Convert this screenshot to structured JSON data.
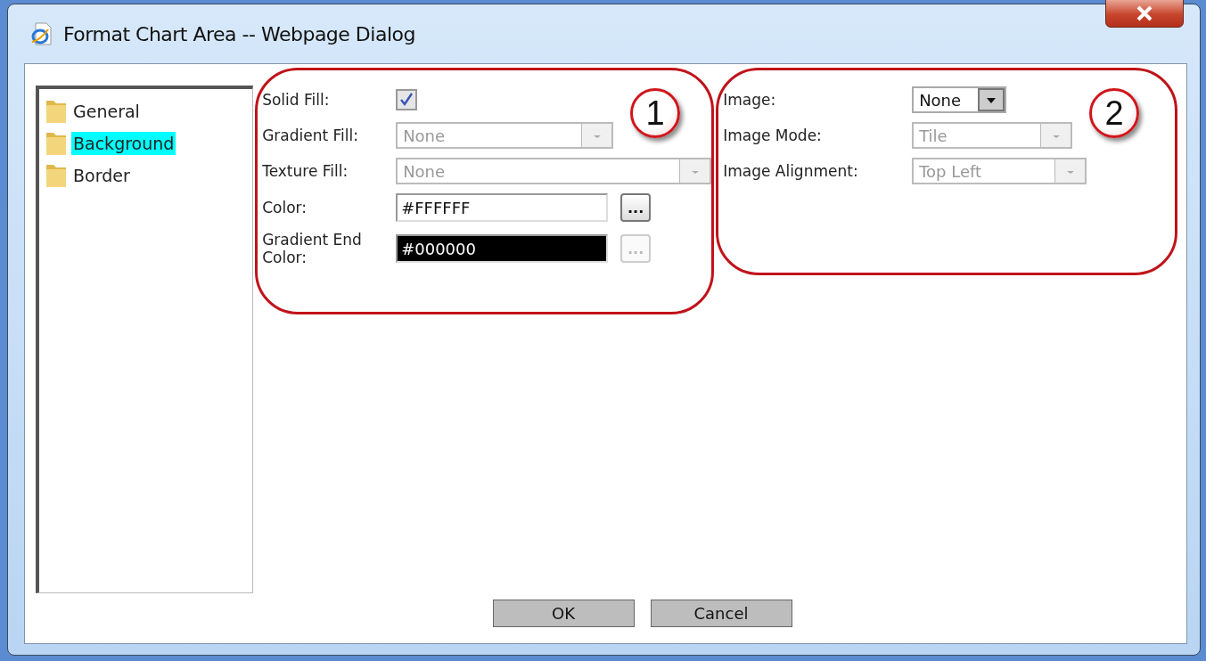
{
  "window": {
    "title": "Format Chart Area -- Webpage Dialog"
  },
  "tree": [
    {
      "label": "General",
      "selected": false
    },
    {
      "label": "Background",
      "selected": true
    },
    {
      "label": "Border",
      "selected": false
    }
  ],
  "sections": [
    {
      "badge": "1",
      "fields": [
        {
          "kind": "checkbox",
          "label": "Solid Fill:",
          "checked": true
        },
        {
          "kind": "select",
          "label": "Gradient Fill:",
          "value": "None",
          "disabled": true
        },
        {
          "kind": "select",
          "label": "Texture Fill:",
          "value": "None",
          "disabled": true
        },
        {
          "kind": "color",
          "label": "Color:",
          "value": "#FFFFFF",
          "color": "#ffffff",
          "button": "...",
          "disabled": false
        },
        {
          "kind": "color",
          "label": "Gradient End Color:",
          "value": "#000000",
          "color": "#000000",
          "button": "...",
          "disabled": true
        }
      ]
    },
    {
      "badge": "2",
      "fields": [
        {
          "kind": "select",
          "label": "Image:",
          "value": "None",
          "disabled": false
        },
        {
          "kind": "select",
          "label": "Image Mode:",
          "value": "Tile",
          "disabled": true
        },
        {
          "kind": "select",
          "label": "Image Alignment:",
          "value": "Top Left",
          "disabled": true
        }
      ]
    }
  ],
  "buttons": [
    "OK",
    "Cancel"
  ]
}
